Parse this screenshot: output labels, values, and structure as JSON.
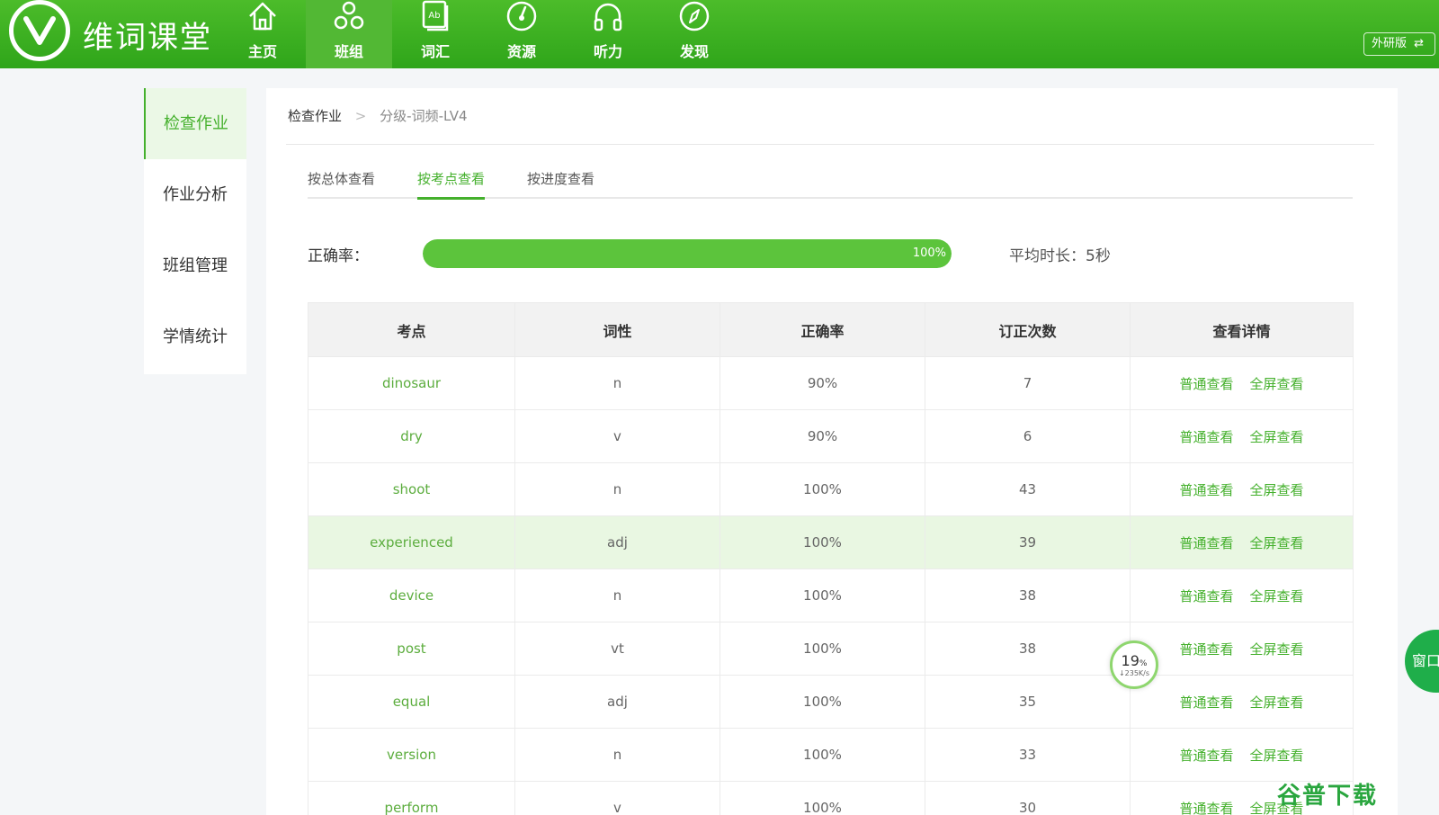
{
  "brand": {
    "name": "维词课堂",
    "logo_letter": "V"
  },
  "nav": [
    {
      "label": "主页",
      "icon": "home-icon"
    },
    {
      "label": "班组",
      "icon": "group-icon"
    },
    {
      "label": "词汇",
      "icon": "vocabulary-book-icon"
    },
    {
      "label": "资源",
      "icon": "resource-dial-icon"
    },
    {
      "label": "听力",
      "icon": "headphones-icon"
    },
    {
      "label": "发现",
      "icon": "compass-icon"
    }
  ],
  "nav_active": "班组",
  "edition": {
    "label": "外研版",
    "icon": "swap-icon"
  },
  "sidebar": [
    {
      "label": "检查作业"
    },
    {
      "label": "作业分析"
    },
    {
      "label": "班组管理"
    },
    {
      "label": "学情统计"
    }
  ],
  "breadcrumb": {
    "root": "检查作业",
    "separator": ">",
    "current": "分级-词频-LV4"
  },
  "tabs": [
    {
      "label": "按总体查看"
    },
    {
      "label": "按考点查看"
    },
    {
      "label": "按进度查看"
    }
  ],
  "accuracy": {
    "label": "正确率：",
    "value": 1.0,
    "text": "100%"
  },
  "avg_time": "平均时长：5秒",
  "table": {
    "headers": [
      "考点",
      "词性",
      "正确率",
      "订正次数",
      "查看详情"
    ],
    "action_normal": "普通查看",
    "action_full": "全屏查看",
    "rows": [
      {
        "word": "dinosaur",
        "pos": "n",
        "rate": "90%",
        "corrections": "7"
      },
      {
        "word": "dry",
        "pos": "v",
        "rate": "90%",
        "corrections": "6"
      },
      {
        "word": "shoot",
        "pos": "n",
        "rate": "100%",
        "corrections": "43"
      },
      {
        "word": "experienced",
        "pos": "adj",
        "rate": "100%",
        "corrections": "39"
      },
      {
        "word": "device",
        "pos": "n",
        "rate": "100%",
        "corrections": "38"
      },
      {
        "word": "post",
        "pos": "vt",
        "rate": "100%",
        "corrections": "38"
      },
      {
        "word": "equal",
        "pos": "adj",
        "rate": "100%",
        "corrections": "35"
      },
      {
        "word": "version",
        "pos": "n",
        "rate": "100%",
        "corrections": "33"
      },
      {
        "word": "perform",
        "pos": "v",
        "rate": "100%",
        "corrections": "30"
      }
    ],
    "highlighted_row": "experienced"
  },
  "speed_widget": {
    "percent": "19",
    "unit": "%",
    "rate": "↓235K/s"
  },
  "float_button": "窗口",
  "watermark": "谷普下载",
  "colors": {
    "brand_green": "#3aaf22",
    "link_green": "#44b02c",
    "highlight_row": "#e9f7e2"
  }
}
